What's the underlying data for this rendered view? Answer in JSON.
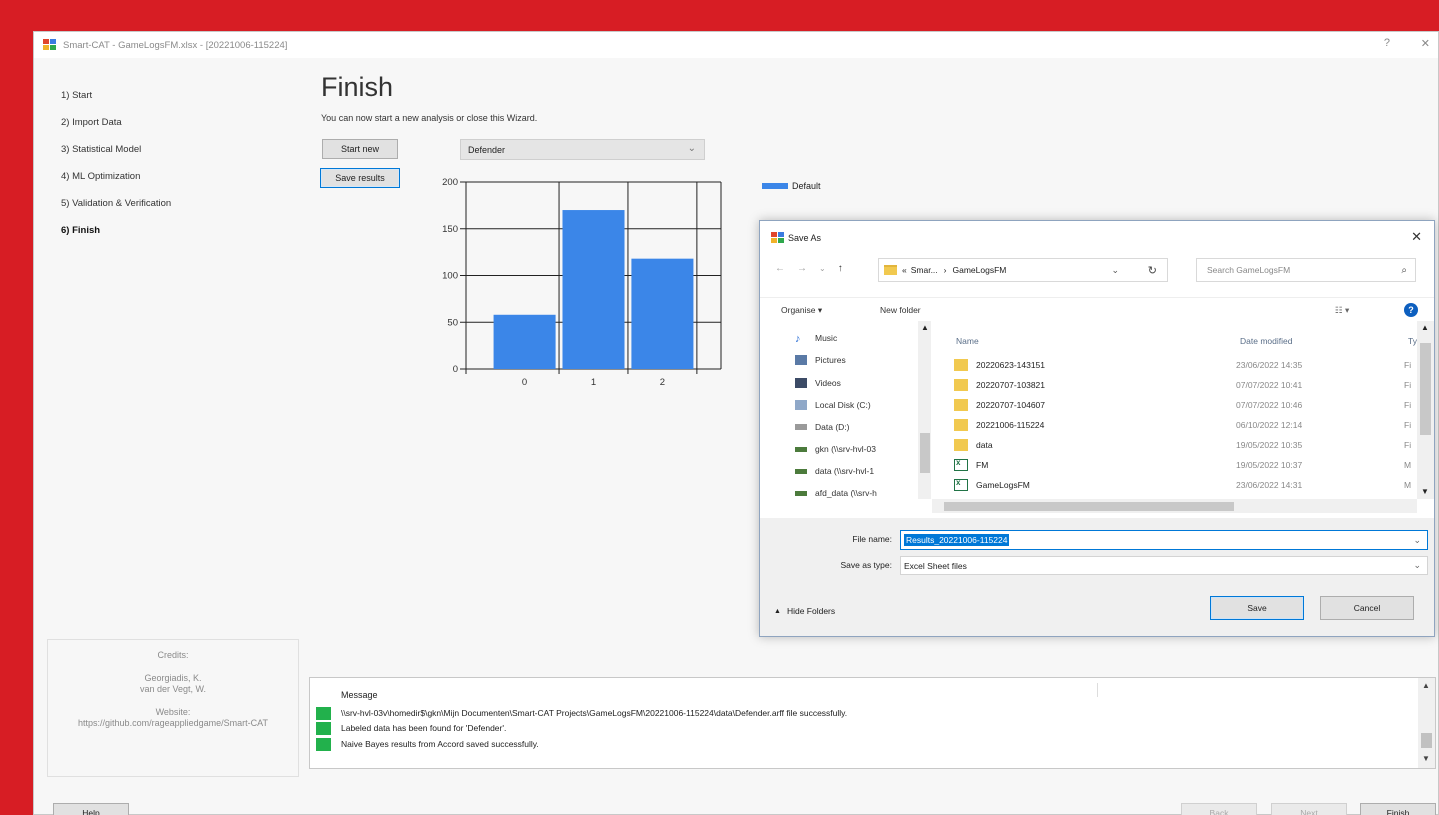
{
  "window": {
    "title": "Smart-CAT - GameLogsFM.xlsx - [20221006-115224]",
    "help_glyph": "?",
    "close_glyph": "✕"
  },
  "sidebar": {
    "steps": [
      {
        "label": "1) Start"
      },
      {
        "label": "2) Import Data"
      },
      {
        "label": "3) Statistical Model"
      },
      {
        "label": "4) ML Optimization"
      },
      {
        "label": "5) Validation & Verification"
      },
      {
        "label": "6) Finish",
        "active": true
      }
    ]
  },
  "credits": {
    "title": "Credits:",
    "author1": "Georgiadis, K.",
    "author2": "van der Vegt, W.",
    "website_label": "Website:",
    "website_url": "https://github.com/rageappliedgame/Smart-CAT"
  },
  "main": {
    "title": "Finish",
    "subtitle": "You can now start a new analysis or close this Wizard.",
    "start_new_label": "Start new",
    "save_results_label": "Save results",
    "dropdown_value": "Defender",
    "legend_label": "Default"
  },
  "chart_data": {
    "type": "bar",
    "categories": [
      "0",
      "1",
      "2"
    ],
    "series": [
      {
        "name": "Default",
        "values": [
          58,
          170,
          118
        ]
      }
    ],
    "y_ticks": [
      0,
      50,
      100,
      150,
      200
    ],
    "ylim": [
      0,
      200
    ],
    "bar_color": "#3b86e8",
    "grid": true,
    "legend_position": "right"
  },
  "messages": {
    "header": "Message",
    "rows": [
      {
        "text": "\\\\srv-hvl-03v\\homedir$\\gkn\\Mijn Documenten\\Smart-CAT Projects\\GameLogsFM\\20221006-115224\\data\\Defender.arff file successfully.",
        "status": "success"
      },
      {
        "text": "Labeled data has been found for 'Defender'.",
        "status": "success"
      },
      {
        "text": "Naive Bayes results from Accord saved successfully.",
        "status": "success"
      }
    ]
  },
  "footer": {
    "help_label": "Help",
    "back_label": "Back",
    "next_label": "Next",
    "finish_label": "Finish"
  },
  "save_dialog": {
    "title": "Save As",
    "close_glyph": "✕",
    "nav_back": "←",
    "nav_forward": "→",
    "nav_recent": "⌄",
    "nav_up": "↑",
    "address_prefix": "«",
    "address_segment1": "Smar...",
    "address_sep": "›",
    "address_segment2": "GameLogsFM",
    "refresh_glyph": "↻",
    "search_placeholder": "Search GameLogsFM",
    "organise_label": "Organise ▾",
    "new_folder_label": "New folder",
    "view_label": "☷ ▾",
    "help_glyph": "?",
    "nav_items": [
      {
        "label": "Music",
        "icon": "music-icon"
      },
      {
        "label": "Pictures",
        "icon": "pictures-icon"
      },
      {
        "label": "Videos",
        "icon": "videos-icon"
      },
      {
        "label": "Local Disk (C:)",
        "icon": "disk-icon"
      },
      {
        "label": "Data (D:)",
        "icon": "disk-icon"
      },
      {
        "label": "gkn (\\\\srv-hvl-03",
        "icon": "network-drive-icon"
      },
      {
        "label": "data (\\\\srv-hvl-1",
        "icon": "network-drive-icon"
      },
      {
        "label": "afd_data (\\\\srv-h",
        "icon": "network-drive-icon"
      }
    ],
    "columns": {
      "name": "Name",
      "date": "Date modified",
      "type": "Ty"
    },
    "files": [
      {
        "name": "20220623-143151",
        "date": "23/06/2022 14:35",
        "type": "Fi",
        "kind": "folder"
      },
      {
        "name": "20220707-103821",
        "date": "07/07/2022 10:41",
        "type": "Fi",
        "kind": "folder"
      },
      {
        "name": "20220707-104607",
        "date": "07/07/2022 10:46",
        "type": "Fi",
        "kind": "folder"
      },
      {
        "name": "20221006-115224",
        "date": "06/10/2022 12:14",
        "type": "Fi",
        "kind": "folder"
      },
      {
        "name": "data",
        "date": "19/05/2022 10:35",
        "type": "Fi",
        "kind": "folder"
      },
      {
        "name": "FM",
        "date": "19/05/2022 10:37",
        "type": "M",
        "kind": "excel"
      },
      {
        "name": "GameLogsFM",
        "date": "23/06/2022 14:31",
        "type": "M",
        "kind": "excel"
      }
    ],
    "file_name_label": "File name:",
    "file_name_value": "Results_20221006-115224",
    "save_type_label": "Save as type:",
    "save_type_value": "Excel Sheet files",
    "hide_folders_label": "Hide Folders",
    "save_label": "Save",
    "cancel_label": "Cancel"
  }
}
